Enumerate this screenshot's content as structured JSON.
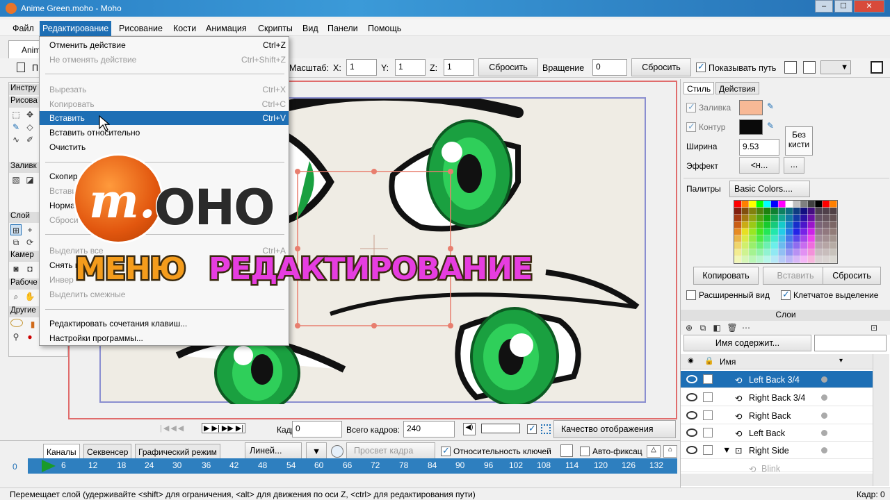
{
  "window": {
    "title": "Anime Green.moho - Moho",
    "min": "–",
    "max": "☐",
    "close": "✕"
  },
  "menubar": [
    "Файл",
    "Редактирование",
    "Рисование",
    "Кости",
    "Анимация",
    "Скрипты",
    "Вид",
    "Панели",
    "Помощь"
  ],
  "doc_tab": "Anim",
  "toolbar": {
    "first_letter": "П",
    "scale_label": "Масштаб:",
    "x_label": "X:",
    "x_val": "1",
    "y_label": "Y:",
    "y_val": "1",
    "z_label": "Z:",
    "z_val": "1",
    "reset1": "Сбросить",
    "rotation_label": "Вращение",
    "rotation_val": "0",
    "reset2": "Сбросить",
    "show_path": "Показывать путь"
  },
  "edit_menu": {
    "items": [
      {
        "label": "Отменить действие",
        "shortcut": "Ctrl+Z",
        "disabled": false
      },
      {
        "label": "Не отменять действие",
        "shortcut": "Ctrl+Shift+Z",
        "disabled": true
      },
      {
        "label": "Вырезать",
        "shortcut": "Ctrl+X",
        "disabled": true
      },
      {
        "label": "Копировать",
        "shortcut": "Ctrl+C",
        "disabled": true
      },
      {
        "label": "Вставить",
        "shortcut": "Ctrl+V",
        "disabled": false,
        "highlighted": true
      },
      {
        "label": "Вставить относительно",
        "shortcut": "",
        "disabled": false
      },
      {
        "label": "Очистить",
        "shortcut": "",
        "disabled": false
      },
      {
        "label": "Скопир",
        "shortcut": "",
        "disabled": false
      },
      {
        "label": "Встави",
        "shortcut": "",
        "disabled": true
      },
      {
        "label": "Норма",
        "shortcut": "",
        "disabled": false
      },
      {
        "label": "Сброси",
        "shortcut": "",
        "disabled": true
      },
      {
        "label": "Выделить все",
        "shortcut": "Ctrl+A",
        "disabled": true
      },
      {
        "label": "Снять в",
        "shortcut": "",
        "disabled": false
      },
      {
        "label": "Инвер",
        "shortcut": "",
        "disabled": true
      },
      {
        "label": "Выделить смежные",
        "shortcut": "",
        "disabled": true
      },
      {
        "label": "Редактировать сочетания клавиш...",
        "shortcut": "",
        "disabled": false
      },
      {
        "label": "Настройки программы...",
        "shortcut": "",
        "disabled": false
      }
    ]
  },
  "left_panel": {
    "sections": [
      "Инстру",
      "Рисова",
      "Заливк",
      "Слой",
      "Камер",
      "Рабоче",
      "Другие"
    ]
  },
  "overlay": {
    "logo_mark": "m.",
    "logo_text": "OHO",
    "word1": "МЕНЮ",
    "word2": "РЕДАКТИРОВАНИЕ"
  },
  "style_panel": {
    "tabs": [
      "Стиль",
      "Действия"
    ],
    "fill_label": "Заливка",
    "stroke_label": "Контур",
    "fill_color": "#f8b996",
    "stroke_color": "#0a0a0a",
    "no_brush": "Без кисти",
    "width_label": "Ширина",
    "width_val": "9.53",
    "effect_label": "Эффект",
    "effect_val": "<н...",
    "effect_more": "...",
    "palettes_label": "Палитры",
    "palette_val": "Basic Colors....",
    "copy_btn": "Копировать",
    "paste_btn": "Вставить",
    "reset_btn": "Сбросить",
    "advanced_view": "Расширенный вид",
    "cell_select": "Клетчатое выделение"
  },
  "layers_panel": {
    "title": "Слои",
    "filter": "Имя содержит...",
    "col_name": "Имя",
    "layers": [
      {
        "name": "Left Back 3/4",
        "selected": true
      },
      {
        "name": "Right Back 3/4",
        "selected": false
      },
      {
        "name": "Right Back",
        "selected": false
      },
      {
        "name": "Left Back",
        "selected": false
      },
      {
        "name": "Right Side",
        "selected": false,
        "group": true
      },
      {
        "name": "Blink",
        "selected": false,
        "faded": true
      }
    ]
  },
  "playbar": {
    "frame_label": "Кадр:",
    "frame_val": "0",
    "total_label": "Всего кадров:",
    "total_val": "240",
    "quality": "Качество отображения"
  },
  "timeline": {
    "tabs": [
      "Каналы",
      "Секвенсер",
      "Графический режим"
    ],
    "interp": "Линей...",
    "onion": "Просвет кадра",
    "relative_keys": "Относительность ключей",
    "autofix": "Авто-фиксац",
    "start": "0",
    "ticks": [
      "6",
      "12",
      "18",
      "24",
      "30",
      "36",
      "42",
      "48",
      "54",
      "60",
      "66",
      "72",
      "78",
      "84",
      "90",
      "96",
      "102",
      "108",
      "114",
      "120",
      "126",
      "132"
    ]
  },
  "status": {
    "message": "Перемещает слой (удерживайте <shift> для ограничения, <alt> для движения по оси Z, <ctrl> для редактирования пути)",
    "frame": "Кадр: 0"
  },
  "palette_colors": [
    "#ff0000",
    "#ff8000",
    "#ffff00",
    "#00ff00",
    "#00ffff",
    "#0000ff",
    "#ff00ff",
    "#ffffff",
    "#c0c0c0",
    "#808080",
    "#404040",
    "#000000"
  ]
}
